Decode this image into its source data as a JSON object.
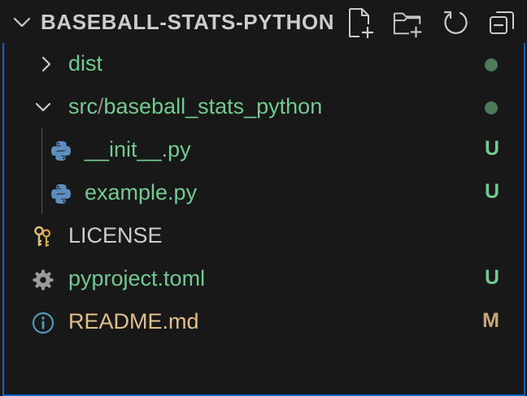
{
  "explorer": {
    "title": "BASEBALL-STATS-PYTHON",
    "actions": [
      {
        "label": "New File...",
        "icon": "new-file-icon"
      },
      {
        "label": "New Folder...",
        "icon": "new-folder-icon"
      },
      {
        "label": "Refresh Explorer",
        "icon": "refresh-icon"
      },
      {
        "label": "Collapse Folders in Explorer",
        "icon": "collapse-all-icon"
      }
    ]
  },
  "colors": {
    "background": "#181818",
    "untracked": "#73c991",
    "modified": "#e2c08d",
    "default_text": "#cccccc",
    "untracked_badge": "#73c991",
    "modified_badge": "#c7a76f",
    "dot": "#4d7a57",
    "focus_border": "#0a64c8"
  },
  "tree": {
    "dist": {
      "name": "dist",
      "expanded": false,
      "status": "dot"
    },
    "src": {
      "name_part1": "src",
      "separator": "/",
      "name_part2": "baseball_stats_python",
      "expanded": true,
      "status": "dot"
    },
    "init": {
      "name": "__init__.py",
      "icon": "python-icon",
      "badge": "U"
    },
    "example": {
      "name": "example.py",
      "icon": "python-icon",
      "badge": "U"
    },
    "license": {
      "name": "LICENSE",
      "icon": "key-icon",
      "badge": ""
    },
    "pyproject": {
      "name": "pyproject.toml",
      "icon": "gear-icon",
      "badge": "U"
    },
    "readme": {
      "name": "README.md",
      "icon": "info-icon",
      "badge": "M"
    }
  }
}
